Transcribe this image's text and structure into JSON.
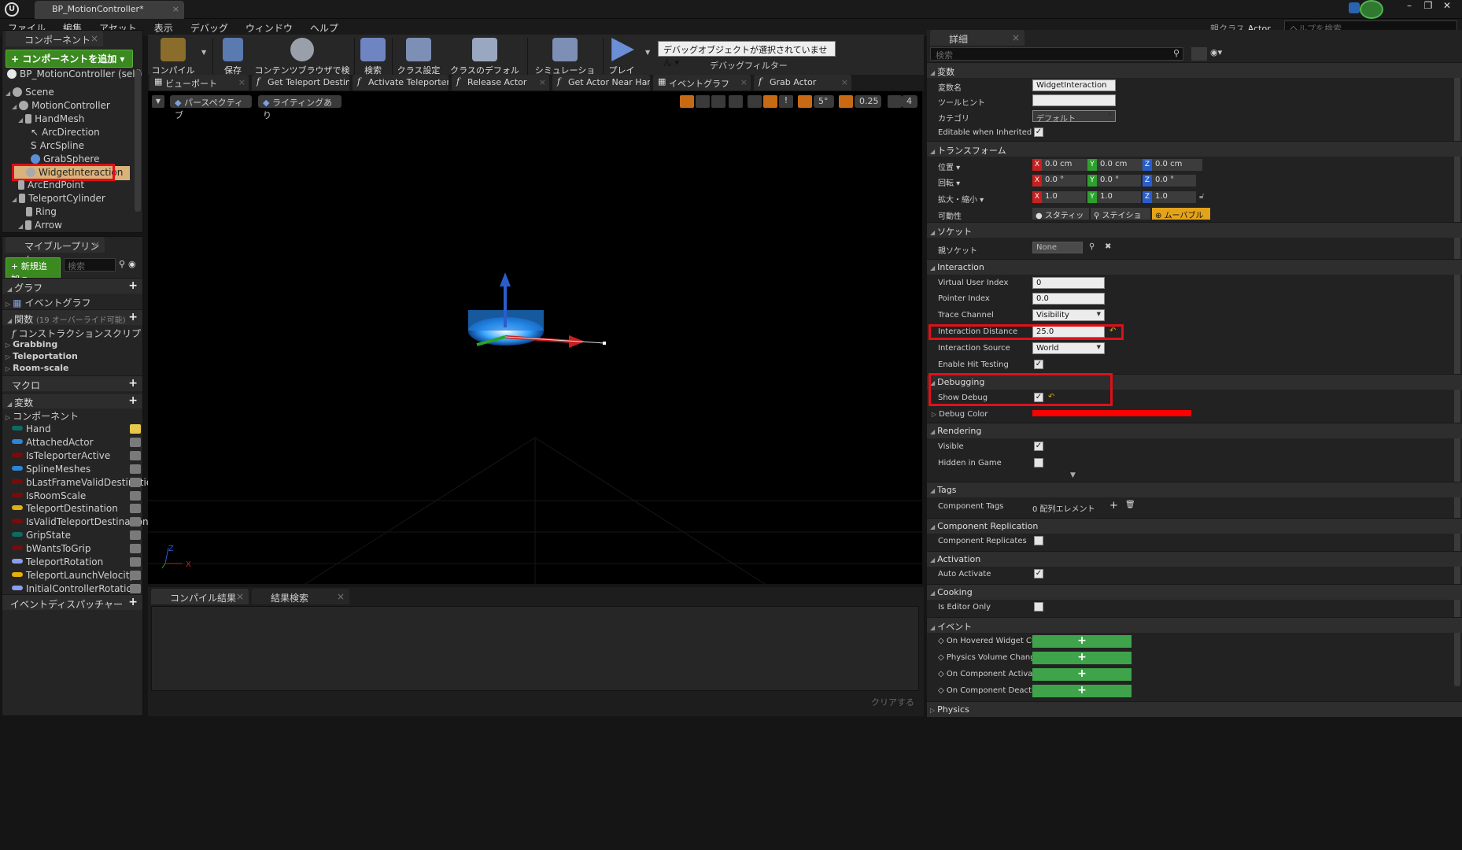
{
  "window": {
    "tab_title": "BP_MotionController*",
    "parent_class_label": "親クラス",
    "parent_class": "Actor",
    "help_search_placeholder": "ヘルプを検索"
  },
  "menu": [
    "ファイル",
    "編集",
    "アセット",
    "表示",
    "デバッグ",
    "ウィンドウ",
    "ヘルプ"
  ],
  "components_panel": {
    "tab": "コンポーネント",
    "add_button": "+ コンポーネントを追加 ▾",
    "self_item": "BP_MotionController (self)",
    "tree": [
      {
        "label": "Scene"
      },
      {
        "label": "MotionController"
      },
      {
        "label": "HandMesh"
      },
      {
        "label": "ArcDirection"
      },
      {
        "label": "ArcSpline"
      },
      {
        "label": "GrabSphere"
      },
      {
        "label": "WidgetInteraction"
      },
      {
        "label": "ArcEndPoint"
      },
      {
        "label": "TeleportCylinder"
      },
      {
        "label": "Ring"
      },
      {
        "label": "Arrow"
      }
    ]
  },
  "my_blueprint": {
    "tab": "マイブループリント",
    "new_button": "+ 新規追加 ▾",
    "search_placeholder": "検索",
    "graph_hdr": "グラフ",
    "event_graph": "イベントグラフ",
    "functions_hdr": "関数",
    "functions_note": "(19 オーバーライド可能)",
    "construction_script": "コンストラクションスクリプ",
    "categories": [
      "Grabbing",
      "Teleportation",
      "Room-scale"
    ],
    "macro_hdr": "マクロ",
    "variables_hdr": "変数",
    "components_cat": "コンポーネント",
    "variables": [
      {
        "name": "Hand",
        "color": "#0e6b62"
      },
      {
        "name": "AttachedActor",
        "color": "#2a86d8"
      },
      {
        "name": "IsTeleporterActive",
        "color": "#7a0b0b"
      },
      {
        "name": "SplineMeshes",
        "color": "#2a86d8"
      },
      {
        "name": "bLastFrameValidDestinatio",
        "color": "#7a0b0b"
      },
      {
        "name": "IsRoomScale",
        "color": "#7a0b0b"
      },
      {
        "name": "TeleportDestination",
        "color": "#e2b10b"
      },
      {
        "name": "IsValidTeleportDestination",
        "color": "#7a0b0b"
      },
      {
        "name": "GripState",
        "color": "#0e6b62"
      },
      {
        "name": "bWantsToGrip",
        "color": "#7a0b0b"
      },
      {
        "name": "TeleportRotation",
        "color": "#8a9ef0"
      },
      {
        "name": "TeleportLaunchVelocity",
        "color": "#e2b10b"
      },
      {
        "name": "InitialControllerRotation",
        "color": "#8a9ef0"
      }
    ],
    "dispatchers_hdr": "イベントディスパッチャー"
  },
  "toolbar": {
    "buttons": [
      "コンパイル",
      "保存",
      "コンテンツブラウザで検索",
      "検索",
      "クラス設定",
      "クラスのデフォルト",
      "シミュレーション",
      "プレイ"
    ],
    "debug_object": "デバッグオブジェクトが選択されていません ▾",
    "debug_filter": "デバッグフィルター"
  },
  "graph_tabs": [
    "ビューポート",
    "Get Teleport Destin",
    "Activate Teleporter",
    "Release Actor",
    "Get Actor Near Han",
    "イベントグラフ",
    "Grab Actor"
  ],
  "viewport": {
    "perspective": "パースペクティブ",
    "lighting": "ライティングあり",
    "rot_snap": "5°",
    "scale_snap": "0.25",
    "cam_speed": "4"
  },
  "output": {
    "tabs": [
      "コンパイル結果",
      "結果検索"
    ],
    "clear": "クリアする"
  },
  "details": {
    "tab": "詳細",
    "search_placeholder": "検索",
    "sec_variable": "変数",
    "var_name_lbl": "変数名",
    "var_name": "WidgetInteraction",
    "tooltip_lbl": "ツールヒント",
    "category_lbl": "カテゴリ",
    "category": "デフォルト",
    "editable_lbl": "Editable when Inherited",
    "sec_transform": "トランスフォーム",
    "location_lbl": "位置 ▾",
    "rotation_lbl": "回転 ▾",
    "scale_lbl": "拡大・縮小 ▾",
    "location": [
      "0.0 cm",
      "0.0 cm",
      "0.0 cm"
    ],
    "rotation": [
      "0.0 °",
      "0.0 °",
      "0.0 °"
    ],
    "scale": [
      "1.0",
      "1.0",
      "1.0"
    ],
    "mobility_lbl": "可動性",
    "mobility": [
      "スタティッ",
      "ステイショ",
      "ムーバブル"
    ],
    "sec_socket": "ソケット",
    "parent_socket_lbl": "親ソケット",
    "parent_socket": "None",
    "sec_interaction": "Interaction",
    "virtual_user_index_lbl": "Virtual User Index",
    "virtual_user_index": "0",
    "pointer_index_lbl": "Pointer Index",
    "pointer_index": "0.0",
    "trace_channel_lbl": "Trace Channel",
    "trace_channel": "Visibility",
    "interaction_distance_lbl": "Interaction Distance",
    "interaction_distance": "25.0",
    "interaction_source_lbl": "Interaction Source",
    "interaction_source": "World",
    "hit_testing_lbl": "Enable Hit Testing",
    "sec_debugging": "Debugging",
    "show_debug_lbl": "Show Debug",
    "debug_color_lbl": "Debug Color",
    "debug_color": "#ff0000",
    "sec_rendering": "Rendering",
    "visible_lbl": "Visible",
    "hidden_lbl": "Hidden in Game",
    "sec_tags": "Tags",
    "component_tags_lbl": "Component Tags",
    "component_tags": "0 配列エレメント",
    "sec_replication": "Component Replication",
    "replicates_lbl": "Component Replicates",
    "sec_activation": "Activation",
    "auto_activate_lbl": "Auto Activate",
    "sec_cooking": "Cooking",
    "editor_only_lbl": "Is Editor Only",
    "sec_events": "イベント",
    "events": [
      "On Hovered Widget Cha",
      "Physics Volume Chang",
      "On Component Activate",
      "On Component Deactiv"
    ],
    "sec_physics": "Physics"
  }
}
